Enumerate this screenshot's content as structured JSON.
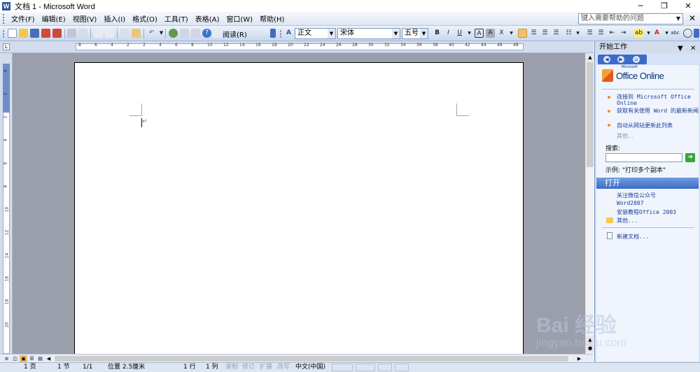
{
  "window": {
    "title": "文档 1 - Microsoft Word",
    "app_icon": "W",
    "min_label": "─",
    "max_label": "❐",
    "close_label": "✕"
  },
  "menubar": {
    "items": [
      "文件(F)",
      "编辑(E)",
      "视图(V)",
      "插入(I)",
      "格式(O)",
      "工具(T)",
      "表格(A)",
      "窗口(W)",
      "帮助(H)"
    ],
    "help_placeholder": "键入需要帮助的问题",
    "close_label": "✕"
  },
  "toolbar": {
    "read_label": "阅读(R)",
    "style": "正文",
    "font": "宋体",
    "size": "五号",
    "bold": "B",
    "italic": "I",
    "underline": "U",
    "char_border": "A",
    "char_shade": "A",
    "scale": "X",
    "highlight": "ab",
    "font_color": "A",
    "other": "abc"
  },
  "hruler": {
    "ticks": [
      "8",
      "6",
      "4",
      "2",
      "2",
      "4",
      "6",
      "8",
      "10",
      "12",
      "14",
      "16",
      "18",
      "20",
      "22",
      "24",
      "26",
      "28",
      "30",
      "32",
      "34",
      "36",
      "38",
      "40",
      "42",
      "44",
      "46",
      "48"
    ]
  },
  "vruler": {
    "ticks": [
      "4",
      "2",
      "2",
      "4",
      "6",
      "8",
      "10",
      "12",
      "14",
      "16",
      "18",
      "20"
    ]
  },
  "statusbar": {
    "page": "1 页",
    "section": "1 节",
    "pages": "1/1",
    "position": "位置 2.5厘米",
    "line": "1 行",
    "column": "1 列",
    "rec": "录制",
    "trk": "修订",
    "ext": "扩展",
    "ovr": "改写",
    "lang": "中文(中国)"
  },
  "taskpane": {
    "title": "开始工作",
    "close_label": "✕",
    "logo_small": "Microsoft",
    "logo_text": "Office Online",
    "links": [
      "连接到 Microsoft Office Online",
      "获取有关使用 Word 的最新新闻",
      "自动从网站更新此列表"
    ],
    "links_more": "其他...",
    "search_label": "搜索:",
    "search_value": "",
    "example": "示例: \"打印多个副本\"",
    "open_section": "打开",
    "recent_files": [
      "关注微信公众号",
      "Word2007",
      "安装教程Office 2003"
    ],
    "open_more": "其他...",
    "new_doc": "新建文档..."
  },
  "watermark": {
    "main": "Bai 经验",
    "sub": "jingyan.baidu.com"
  },
  "colors": {
    "accent": "#3d6bc7",
    "doc_bg": "#9b9fab"
  }
}
